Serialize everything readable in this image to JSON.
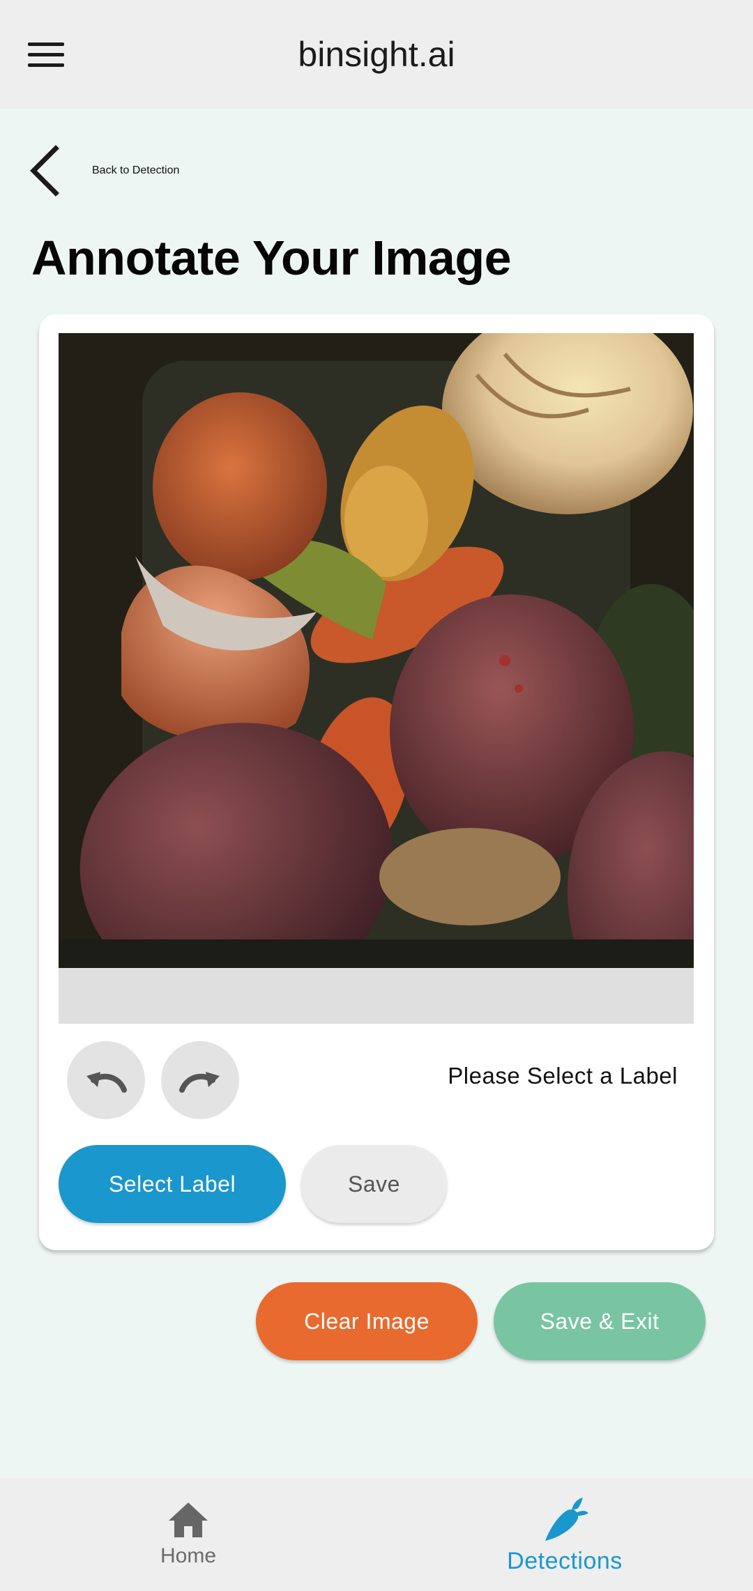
{
  "header": {
    "menu_icon": "hamburger-menu-icon",
    "title": "binsight.ai"
  },
  "back": {
    "icon": "chevron-left-icon",
    "label": "Back to Detection"
  },
  "page": {
    "title": "Annotate Your Image"
  },
  "annotator": {
    "undo_icon": "undo-icon",
    "redo_icon": "redo-icon",
    "status_text": "Please Select a Label",
    "select_label_button": "Select Label",
    "save_button": "Save"
  },
  "actions": {
    "clear_button": "Clear Image",
    "save_exit_button": "Save & Exit"
  },
  "nav": {
    "items": [
      {
        "label": "Home",
        "icon": "home-icon",
        "active": false
      },
      {
        "label": "Detections",
        "icon": "carrot-icon",
        "active": true
      }
    ]
  },
  "colors": {
    "accent_blue": "#1a97cd",
    "clear_orange": "#e96a2e",
    "save_exit_green": "#79c4a2",
    "page_bg": "#eef6f3"
  }
}
